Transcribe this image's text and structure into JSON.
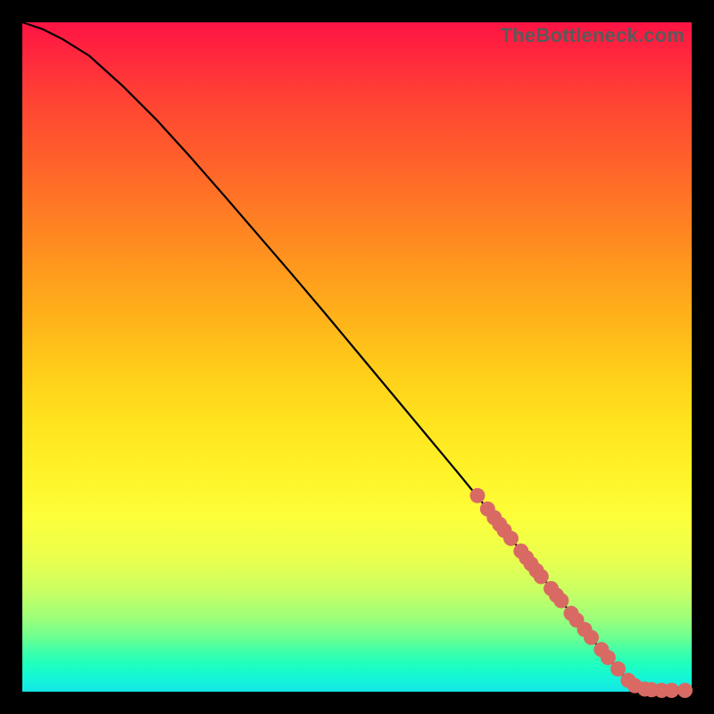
{
  "watermark": "TheBottleneck.com",
  "colors": {
    "marker": "#d86a63",
    "curve": "#000000"
  },
  "chart_data": {
    "type": "line",
    "title": "",
    "xlabel": "",
    "ylabel": "",
    "xlim": [
      0,
      100
    ],
    "ylim": [
      0,
      100
    ],
    "series": [
      {
        "name": "bottleneck-curve",
        "x": [
          0,
          3,
          6,
          10,
          15,
          20,
          25,
          30,
          35,
          40,
          45,
          50,
          55,
          60,
          65,
          70,
          73,
          75,
          78,
          80,
          82,
          84,
          86,
          88,
          90,
          91,
          92,
          93,
          95,
          97,
          100
        ],
        "y": [
          100,
          99,
          97.5,
          95,
          90.5,
          85.5,
          80,
          74.3,
          68.5,
          62.7,
          56.8,
          50.8,
          44.8,
          38.8,
          32.8,
          26.7,
          22.9,
          20.4,
          16.7,
          14.2,
          11.7,
          9.3,
          6.8,
          4.5,
          2.2,
          1.2,
          0.7,
          0.4,
          0.2,
          0.2,
          0.2
        ]
      }
    ],
    "highlighted_points": {
      "name": "marker-cluster",
      "x": [
        68,
        69.5,
        70.5,
        71.3,
        72.0,
        73.0,
        74.5,
        75.3,
        76.0,
        76.8,
        77.5,
        79.0,
        79.8,
        80.5,
        82.0,
        82.8,
        84.0,
        85.0,
        86.5,
        87.5,
        89.0,
        90.5,
        91.5,
        93.0,
        94.0,
        95.5,
        97.0,
        99.0
      ],
      "y": [
        29.3,
        27.3,
        26.0,
        25.0,
        24.1,
        22.9,
        21.0,
        20.0,
        19.1,
        18.1,
        17.2,
        15.4,
        14.4,
        13.6,
        11.7,
        10.7,
        9.3,
        8.1,
        6.3,
        5.1,
        3.4,
        1.7,
        0.9,
        0.4,
        0.3,
        0.2,
        0.2,
        0.2
      ]
    }
  }
}
